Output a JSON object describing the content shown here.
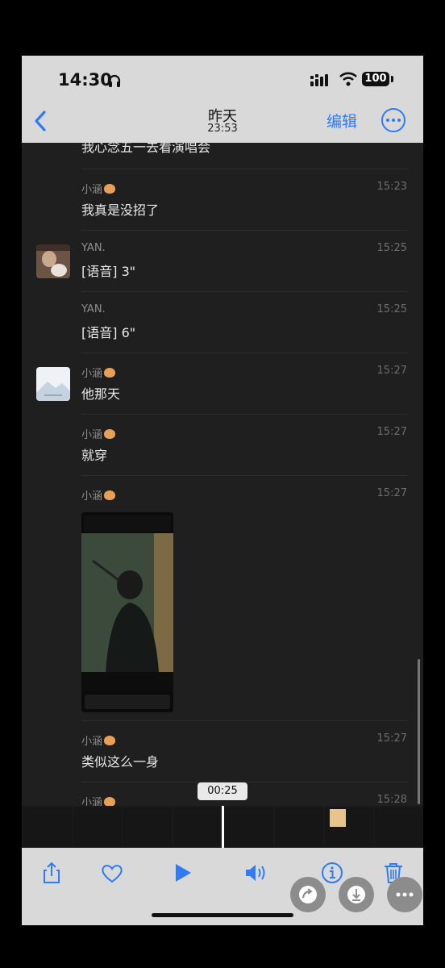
{
  "status": {
    "time": "14:30",
    "battery": "100"
  },
  "nav": {
    "date": "昨天",
    "time": "23:53",
    "edit_label": "编辑"
  },
  "partial_message": {
    "text": "我心念五一去看演唱会"
  },
  "messages": [
    {
      "sender": "小涵",
      "has_emoji": true,
      "time": "15:23",
      "text": "我真是没招了"
    },
    {
      "sender": "YAN.",
      "has_emoji": false,
      "time": "15:25",
      "text": "[语音] 3\""
    },
    {
      "sender": "YAN.",
      "has_emoji": false,
      "time": "15:25",
      "text": "[语音] 6\""
    },
    {
      "sender": "小涵",
      "has_emoji": true,
      "time": "15:27",
      "text": "他那天"
    },
    {
      "sender": "小涵",
      "has_emoji": true,
      "time": "15:27",
      "text": "就穿"
    },
    {
      "sender": "小涵",
      "has_emoji": true,
      "time": "15:27",
      "text": ""
    },
    {
      "sender": "小涵",
      "has_emoji": true,
      "time": "15:27",
      "text": "类似这么一身"
    },
    {
      "sender": "小涵",
      "has_emoji": true,
      "time": "15:28",
      "text": ""
    }
  ],
  "video": {
    "current_time": "00:25"
  },
  "colors": {
    "accent": "#2d7cf6",
    "chat_bg": "#1f1f1f",
    "chrome_bg": "#d9d9d9"
  },
  "icons": [
    "headphones-icon",
    "signal-icon",
    "wifi-icon",
    "battery-icon",
    "back-chevron-icon",
    "more-icon",
    "share-icon",
    "heart-icon",
    "play-icon",
    "volume-icon",
    "info-icon",
    "trash-icon",
    "forward-icon",
    "download-icon"
  ]
}
